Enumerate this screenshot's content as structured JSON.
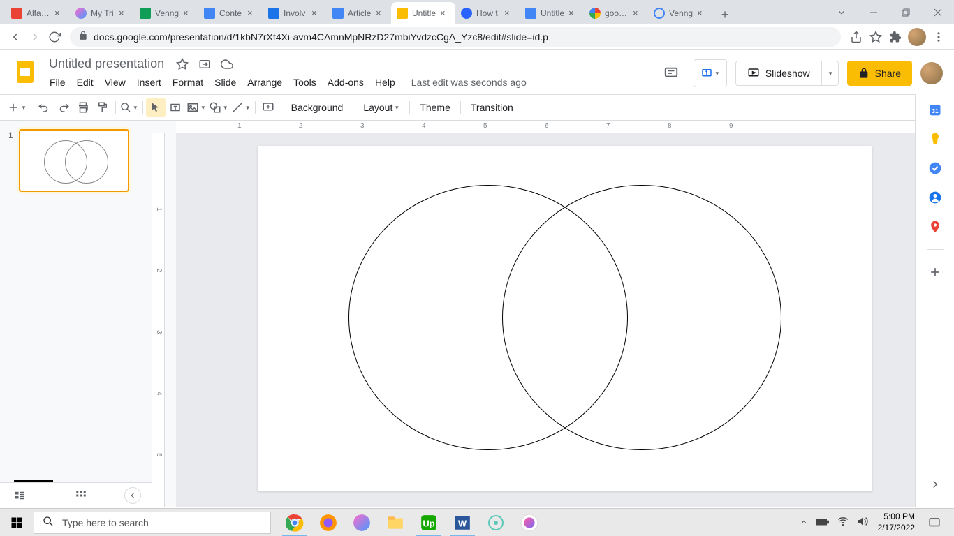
{
  "browser": {
    "tabs": [
      {
        "title": "Alfafus",
        "favicon": "fi-red"
      },
      {
        "title": "My Tri",
        "favicon": "fi-mess"
      },
      {
        "title": "Venng",
        "favicon": "fi-green"
      },
      {
        "title": "Conte",
        "favicon": "fi-blue"
      },
      {
        "title": "Involv",
        "favicon": "fi-dblue"
      },
      {
        "title": "Article",
        "favicon": "fi-blue"
      },
      {
        "title": "Untitle",
        "favicon": "fi-yellow",
        "active": true
      },
      {
        "title": "How t",
        "favicon": "fi-dcircle"
      },
      {
        "title": "Untitle",
        "favicon": "fi-blue"
      },
      {
        "title": "google",
        "favicon": "fi-google"
      },
      {
        "title": "Venng",
        "favicon": "fi-circle"
      }
    ],
    "url": "docs.google.com/presentation/d/1kbN7rXt4Xi-avm4CAmnMpNRzD27mbiYvdzcCgA_Yzc8/edit#slide=id.p"
  },
  "doc": {
    "title": "Untitled presentation",
    "last_edit": "Last edit was seconds ago"
  },
  "menus": [
    "File",
    "Edit",
    "View",
    "Insert",
    "Format",
    "Slide",
    "Arrange",
    "Tools",
    "Add-ons",
    "Help"
  ],
  "header_buttons": {
    "slideshow": "Slideshow",
    "share": "Share"
  },
  "toolbar": {
    "background": "Background",
    "layout": "Layout",
    "theme": "Theme",
    "transition": "Transition"
  },
  "ruler_h": [
    "1",
    "2",
    "3",
    "4",
    "5",
    "6",
    "7",
    "8",
    "9"
  ],
  "ruler_v": [
    "1",
    "2",
    "3",
    "4",
    "5"
  ],
  "slide_panel": {
    "slide_num": "1"
  },
  "taskbar": {
    "search_placeholder": "Type here to search",
    "time": "5:00 PM",
    "date": "2/17/2022"
  }
}
